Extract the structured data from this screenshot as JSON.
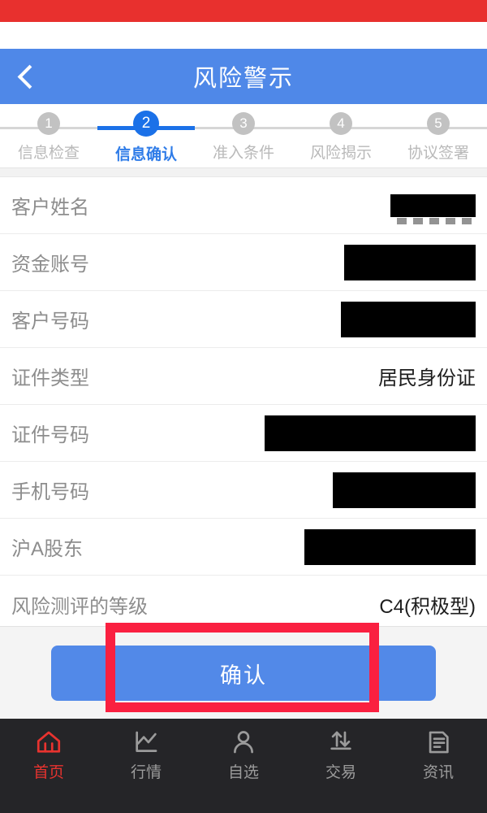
{
  "colors": {
    "status_bar_red": "#e8302e",
    "header_blue": "#4f88e8",
    "step_active_blue": "#1b71e8",
    "step_inactive_gray": "#c2c2c2",
    "button_blue": "#5289e8",
    "annotation_red": "#fa2040",
    "nav_background": "#252528",
    "nav_active_red": "#e8332f"
  },
  "header": {
    "title": "风险警示",
    "back_icon": "chevron-left-icon"
  },
  "stepper": {
    "active_index": 2,
    "steps": [
      {
        "number": "1",
        "label": "信息检查"
      },
      {
        "number": "2",
        "label": "信息确认"
      },
      {
        "number": "3",
        "label": "准入条件"
      },
      {
        "number": "4",
        "label": "风险揭示"
      },
      {
        "number": "5",
        "label": "协议签署"
      }
    ]
  },
  "form": {
    "rows": [
      {
        "label": "客户姓名",
        "value": "",
        "redacted": true,
        "redact_width": 105,
        "redact_style": "ghost"
      },
      {
        "label": "资金账号",
        "value": "",
        "redacted": true,
        "redact_width": 162,
        "redact_style": "solid"
      },
      {
        "label": "客户号码",
        "value": "",
        "redacted": true,
        "redact_width": 166,
        "redact_style": "solid"
      },
      {
        "label": "证件类型",
        "value": "居民身份证",
        "redacted": false,
        "redact_width": 0,
        "redact_style": ""
      },
      {
        "label": "证件号码",
        "value": "",
        "redacted": true,
        "redact_width": 260,
        "redact_style": "solid"
      },
      {
        "label": "手机号码",
        "value": "",
        "redacted": true,
        "redact_width": 176,
        "redact_style": "solid"
      },
      {
        "label": "沪A股东",
        "value": "",
        "redacted": true,
        "redact_width": 211,
        "redact_style": "solid"
      },
      {
        "label": "风险测评的等级",
        "value": "C4(积极型)",
        "redacted": false,
        "redact_width": 0,
        "redact_style": ""
      }
    ]
  },
  "footer": {
    "confirm_label": "确认",
    "annotation": "red-highlight-rectangle"
  },
  "navbar": {
    "active_index": 0,
    "items": [
      {
        "label": "首页",
        "icon": "home-icon"
      },
      {
        "label": "行情",
        "icon": "line-chart-icon"
      },
      {
        "label": "自选",
        "icon": "person-icon"
      },
      {
        "label": "交易",
        "icon": "up-down-arrows-icon"
      },
      {
        "label": "资讯",
        "icon": "document-icon"
      }
    ]
  }
}
